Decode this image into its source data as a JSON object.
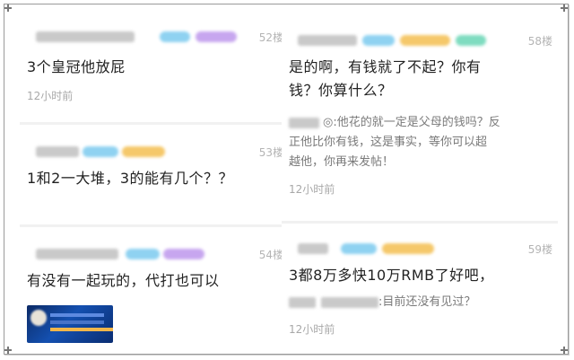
{
  "posts_left": [
    {
      "floor": "52楼",
      "content": "3个皇冠他放屁",
      "time": "12小时前"
    },
    {
      "floor": "53楼",
      "content": "1和2一大堆，3的能有几个？？",
      "time": ""
    },
    {
      "floor": "54楼",
      "content": "有没有一起玩的，代打也可以",
      "time": ""
    }
  ],
  "posts_right": [
    {
      "floor": "58楼",
      "content_line1": "是的啊，有钱就了不起？你有",
      "content_line2": "钱？你算什么？",
      "quote_line1": "◎:他花的就一定是父母的钱吗？反",
      "quote_line2": "正他比你有钱，这是事实，等你可以超",
      "quote_line3": "越他，你再来发帖！",
      "time": "12小时前"
    },
    {
      "floor": "59楼",
      "content": "3都8万多快10万RMB了好吧，",
      "quote": ":目前还没有见过？",
      "time": "12小时前"
    }
  ]
}
